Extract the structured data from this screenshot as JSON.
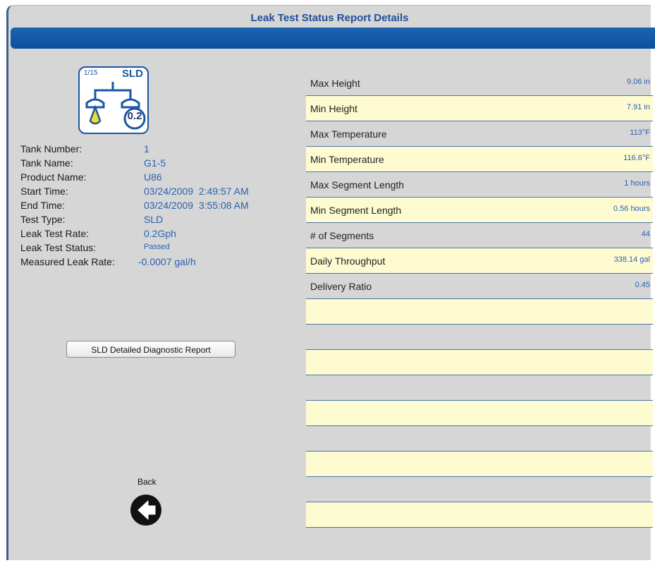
{
  "header": {
    "title": "Leak Test Status Report Details"
  },
  "tank_icon": {
    "position_text": "1/15",
    "type_text": "SLD",
    "rate_text": "0.2",
    "icon_name": "tank-sld-icon",
    "accent_color": "#1a55a5",
    "drop_color": "#f3dc2a"
  },
  "info": [
    {
      "label": "Tank Number:",
      "value": "1"
    },
    {
      "label": "Tank Name:",
      "value": "G1-5"
    },
    {
      "label": "Product Name:",
      "value": "U86"
    },
    {
      "label": "Start Time:",
      "value": "03/24/2009  2:49:57 AM"
    },
    {
      "label": "End Time:",
      "value": "03/24/2009  3:55:08 AM"
    },
    {
      "label": "Test Type:",
      "value": "SLD"
    },
    {
      "label": "Leak Test Rate:",
      "value": "0.2Gph"
    },
    {
      "label": "Leak Test Status:",
      "value": "Passed"
    },
    {
      "label": "Measured Leak Rate:",
      "value": "-0.0007 gal/h"
    }
  ],
  "diagnostic_button": {
    "label": "SLD Detailed Diagnostic Report"
  },
  "back": {
    "label": "Back",
    "icon_name": "back-arrow-icon"
  },
  "metrics": [
    {
      "label": "Max Height",
      "value": "9.06 in"
    },
    {
      "label": "Min Height",
      "value": "7.91 in"
    },
    {
      "label": "Max Temperature",
      "value": "113°F"
    },
    {
      "label": "Min Temperature",
      "value": "116.6°F"
    },
    {
      "label": "Max Segment Length",
      "value": "1 hours"
    },
    {
      "label": "Min Segment Length",
      "value": "0.56 hours"
    },
    {
      "label": "# of Segments",
      "value": "44"
    },
    {
      "label": "Daily Throughput",
      "value": "338.14 gal"
    },
    {
      "label": "Delivery Ratio",
      "value": "0.45"
    },
    {
      "label": "",
      "value": ""
    },
    {
      "label": "",
      "value": ""
    },
    {
      "label": "",
      "value": ""
    },
    {
      "label": "",
      "value": ""
    },
    {
      "label": "",
      "value": ""
    },
    {
      "label": "",
      "value": ""
    },
    {
      "label": "",
      "value": ""
    },
    {
      "label": "",
      "value": ""
    },
    {
      "label": "",
      "value": ""
    },
    {
      "label": "",
      "value": ""
    }
  ],
  "colors": {
    "header_bar": "#0b4f9c",
    "title_text": "#1f4f99",
    "value_text": "#2a62b0",
    "row_highlight": "#fefbd0",
    "panel_bg": "#d6d6d6"
  }
}
